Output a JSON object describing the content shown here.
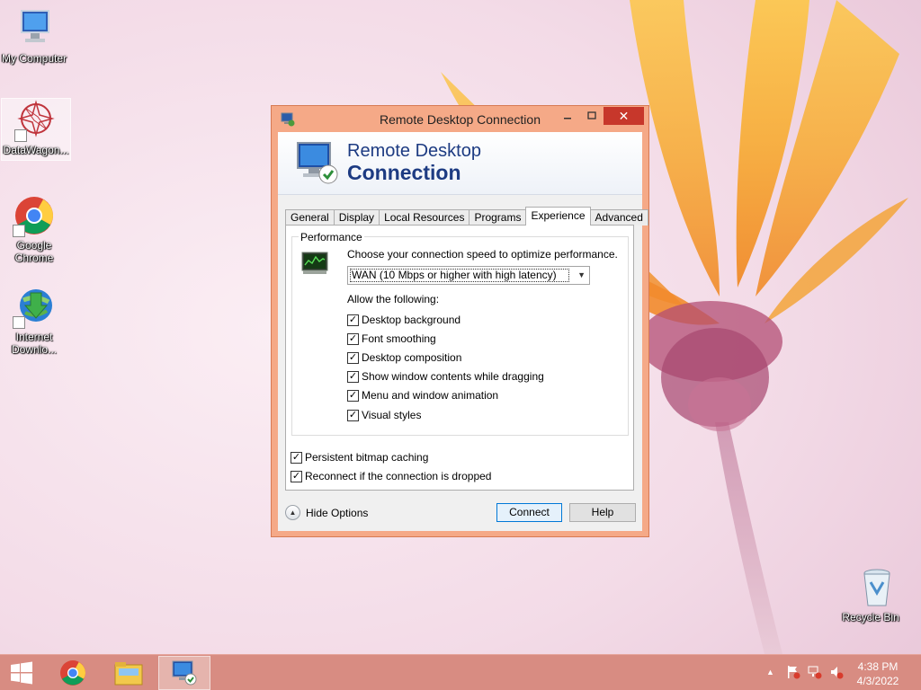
{
  "desktop": {
    "icons": [
      {
        "label": "My Computer"
      },
      {
        "label": "DataWagon..."
      },
      {
        "label": "Google Chrome"
      },
      {
        "label": "Internet Downlo..."
      },
      {
        "label": "Recycle Bin"
      }
    ]
  },
  "window": {
    "title": "Remote Desktop Connection",
    "banner": {
      "line1": "Remote Desktop",
      "line2": "Connection"
    },
    "tabs": [
      {
        "label": "General",
        "active": false
      },
      {
        "label": "Display",
        "active": false
      },
      {
        "label": "Local Resources",
        "active": false
      },
      {
        "label": "Programs",
        "active": false
      },
      {
        "label": "Experience",
        "active": true
      },
      {
        "label": "Advanced",
        "active": false
      }
    ],
    "performance": {
      "group_label": "Performance",
      "speed_label": "Choose your connection speed to optimize performance.",
      "speed_selected": "WAN (10 Mbps or higher with high latency)",
      "allow_label": "Allow the following:",
      "options": [
        {
          "label": "Desktop background",
          "checked": true
        },
        {
          "label": "Font smoothing",
          "checked": true
        },
        {
          "label": "Desktop composition",
          "checked": true
        },
        {
          "label": "Show window contents while dragging",
          "checked": true
        },
        {
          "label": "Menu and window animation",
          "checked": true
        },
        {
          "label": "Visual styles",
          "checked": true
        }
      ]
    },
    "extra_options": [
      {
        "label": "Persistent bitmap caching",
        "checked": true
      },
      {
        "label": "Reconnect if the connection is dropped",
        "checked": true
      }
    ],
    "hide_options": "Hide Options",
    "connect_button": "Connect",
    "help_button": "Help",
    "close_glyph": "✕"
  },
  "taskbar": {
    "clock_time": "4:38 PM",
    "clock_date": "4/3/2022"
  },
  "colors": {
    "titlebar": "#f5a987",
    "close": "#c7372b",
    "banner_text": "#1d3b82",
    "taskbar": "#d88c82"
  }
}
